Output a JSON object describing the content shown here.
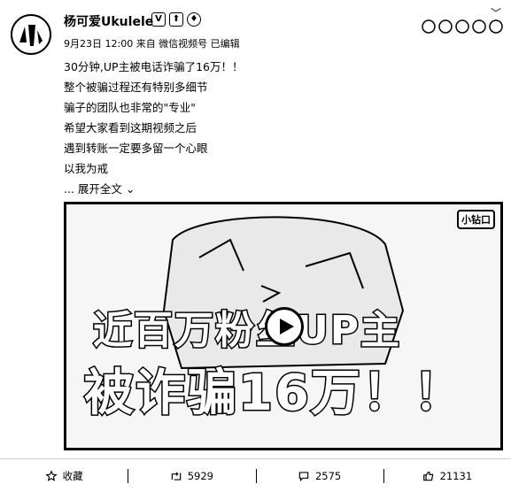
{
  "post": {
    "username": "杨可爱Ukulele",
    "verified_badge": "V",
    "meta": "9月23日 12:00 来自 微信视频号   已编辑",
    "lines": [
      "30分钟,UP主被电话诈骗了16万！！",
      "整个被骗过程还有特别多细节",
      "骗子的团队也非常的\"专业\"",
      "希望大家看到这期视频之后",
      "遇到转账一定要多留一个心眼",
      "以我为戒"
    ],
    "expand_label": "... 展开全文"
  },
  "video": {
    "source_badge": "小钻口",
    "title_line1": "近百万粉丝UP主",
    "title_line2": "被诈骗16万！！"
  },
  "actions": {
    "favorite_label": "收藏",
    "repost_count": "5929",
    "comment_count": "2575",
    "like_count": "21131"
  },
  "icons": [
    "avatar-image",
    "verified-icon",
    "level-icon",
    "vip-icon",
    "chevron-down-icon",
    "star-icon",
    "repost-icon",
    "comment-icon",
    "like-icon",
    "play-icon"
  ]
}
